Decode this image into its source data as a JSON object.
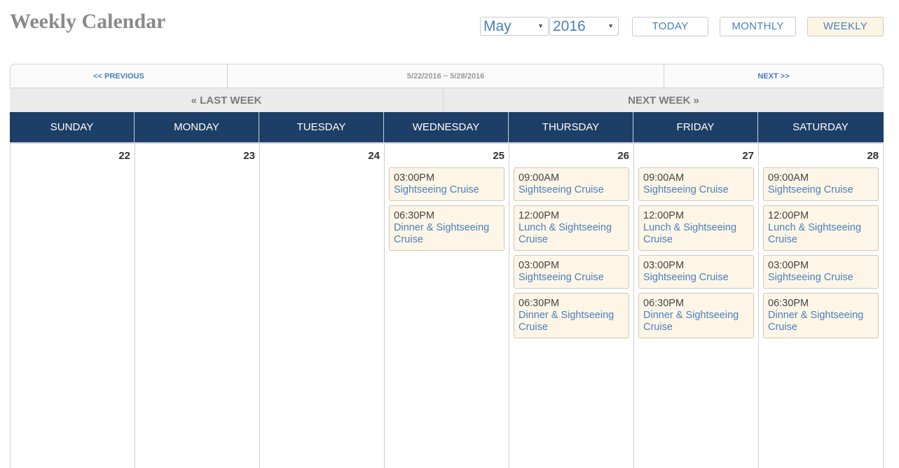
{
  "header": {
    "title": "Weekly Calendar",
    "month": "May",
    "year": "2016",
    "caret": "▼",
    "today_label": "TODAY",
    "monthly_label": "MONTHLY",
    "weekly_label": "WEEKLY"
  },
  "range_nav": {
    "previous": "<< PREVIOUS",
    "range": "5/22/2016 ~ 5/28/2016",
    "next": "NEXT >>"
  },
  "week_nav": {
    "last_week": "« LAST WEEK",
    "next_week": "NEXT WEEK »"
  },
  "colors": {
    "header_bg": "#1d3e66",
    "link": "#4a7fbd",
    "event_bg": "#fdf6e7",
    "active_view_bg": "#fdf5e4"
  },
  "days": [
    {
      "name": "SUNDAY",
      "date": "22",
      "events": []
    },
    {
      "name": "MONDAY",
      "date": "23",
      "events": []
    },
    {
      "name": "TUESDAY",
      "date": "24",
      "events": []
    },
    {
      "name": "WEDNESDAY",
      "date": "25",
      "events": [
        {
          "time": "03:00PM",
          "title": "Sightseeing Cruise"
        },
        {
          "time": "06:30PM",
          "title": "Dinner & Sightseeing Cruise"
        }
      ]
    },
    {
      "name": "THURSDAY",
      "date": "26",
      "events": [
        {
          "time": "09:00AM",
          "title": "Sightseeing Cruise"
        },
        {
          "time": "12:00PM",
          "title": "Lunch & Sightseeing Cruise"
        },
        {
          "time": "03:00PM",
          "title": "Sightseeing Cruise"
        },
        {
          "time": "06:30PM",
          "title": "Dinner & Sightseeing Cruise"
        }
      ]
    },
    {
      "name": "FRIDAY",
      "date": "27",
      "events": [
        {
          "time": "09:00AM",
          "title": "Sightseeing Cruise"
        },
        {
          "time": "12:00PM",
          "title": "Lunch & Sightseeing Cruise"
        },
        {
          "time": "03:00PM",
          "title": "Sightseeing Cruise"
        },
        {
          "time": "06:30PM",
          "title": "Dinner & Sightseeing Cruise"
        }
      ]
    },
    {
      "name": "SATURDAY",
      "date": "28",
      "events": [
        {
          "time": "09:00AM",
          "title": "Sightseeing Cruise"
        },
        {
          "time": "12:00PM",
          "title": "Lunch & Sightseeing Cruise"
        },
        {
          "time": "03:00PM",
          "title": "Sightseeing Cruise"
        },
        {
          "time": "06:30PM",
          "title": "Dinner & Sightseeing Cruise"
        }
      ]
    }
  ]
}
